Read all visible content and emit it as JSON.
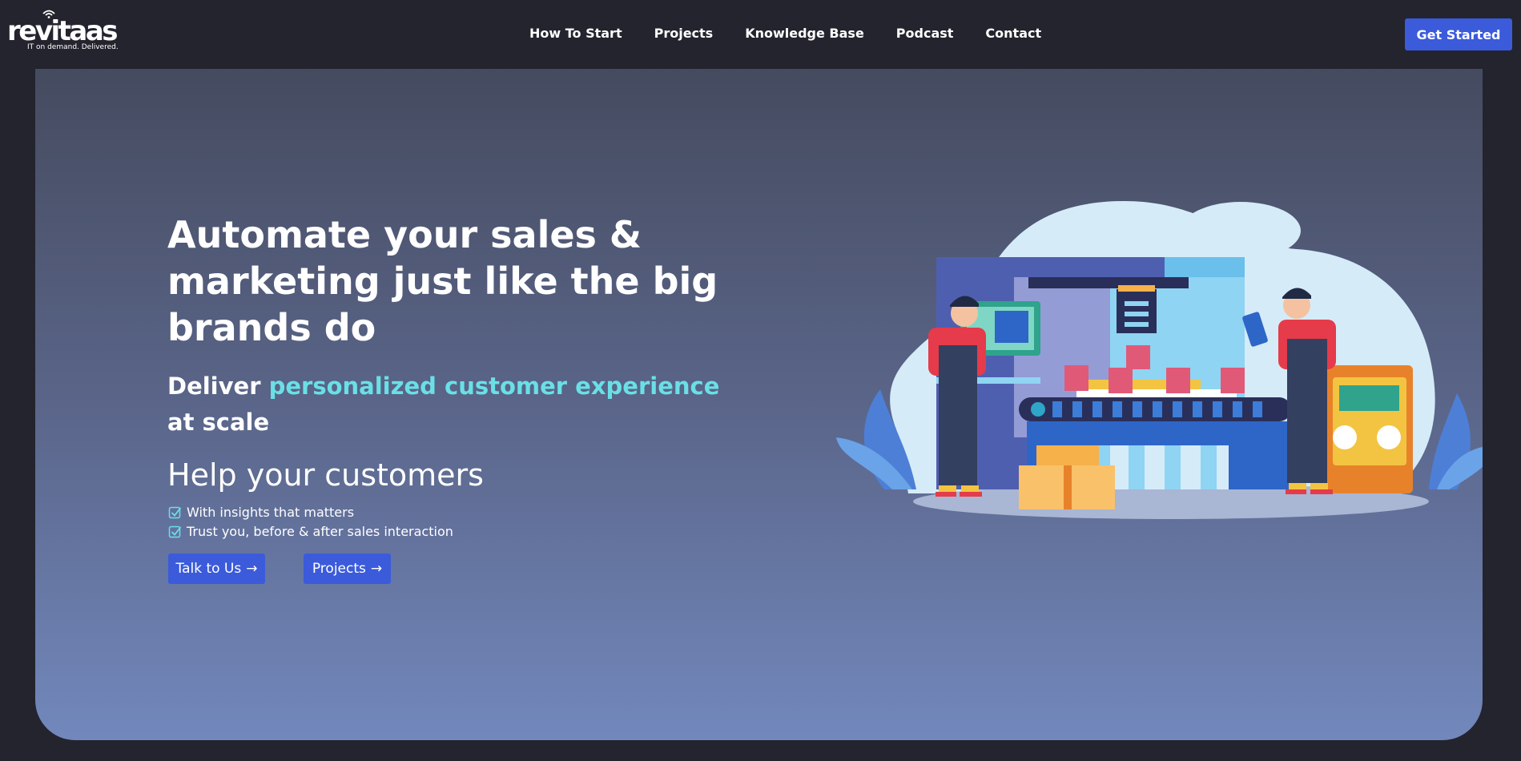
{
  "brand": {
    "name": "revitaas",
    "tagline": "IT on demand. Delivered."
  },
  "nav": {
    "items": [
      {
        "label": "How To Start"
      },
      {
        "label": "Projects"
      },
      {
        "label": "Knowledge Base"
      },
      {
        "label": "Podcast"
      },
      {
        "label": "Contact"
      }
    ],
    "cta_label": "Get Started"
  },
  "hero": {
    "headline": "Automate your sales & marketing just like the big brands do",
    "sub_prefix": "Deliver ",
    "sub_highlight": "personalized customer experience",
    "sub_suffix": " at scale",
    "help_title": "Help your customers",
    "bullets": [
      {
        "text": "With insights that matters"
      },
      {
        "text": "Trust you, before & after sales interaction"
      }
    ],
    "buttons": {
      "talk_label": "Talk to Us",
      "projects_label": "Projects",
      "arrow": "→"
    }
  },
  "colors": {
    "background": "#23242e",
    "accent": "#3b5bdb",
    "highlight": "#6ae0e6"
  },
  "icons": [
    "wifi-icon",
    "check-icon",
    "arrow-right-icon"
  ]
}
